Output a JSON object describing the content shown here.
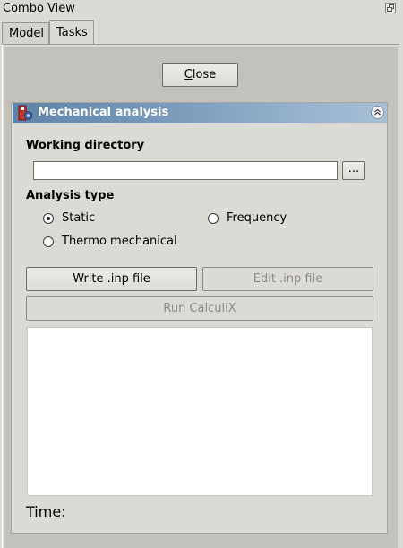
{
  "window": {
    "title": "Combo View"
  },
  "tabs": [
    {
      "label": "Model",
      "active": false
    },
    {
      "label": "Tasks",
      "active": true
    }
  ],
  "close_button": {
    "label_before": "",
    "mnemonic": "C",
    "label_after": "lose"
  },
  "task_panel": {
    "title": "Mechanical analysis",
    "icon": "fem-analysis-icon",
    "header_color_start": "#5f82a8",
    "header_color_end": "#a9c0d6",
    "working_directory": {
      "label": "Working directory",
      "value": "",
      "browse_label": "..."
    },
    "analysis_type": {
      "label": "Analysis type",
      "options": [
        {
          "label": "Static",
          "selected": true
        },
        {
          "label": "Frequency",
          "selected": false
        },
        {
          "label": "Thermo mechanical",
          "selected": false
        }
      ]
    },
    "buttons": {
      "write_inp": "Write .inp file",
      "edit_inp": "Edit .inp file",
      "run_calculix": "Run CalculiX"
    },
    "output_text": "",
    "time_label": "Time:"
  }
}
